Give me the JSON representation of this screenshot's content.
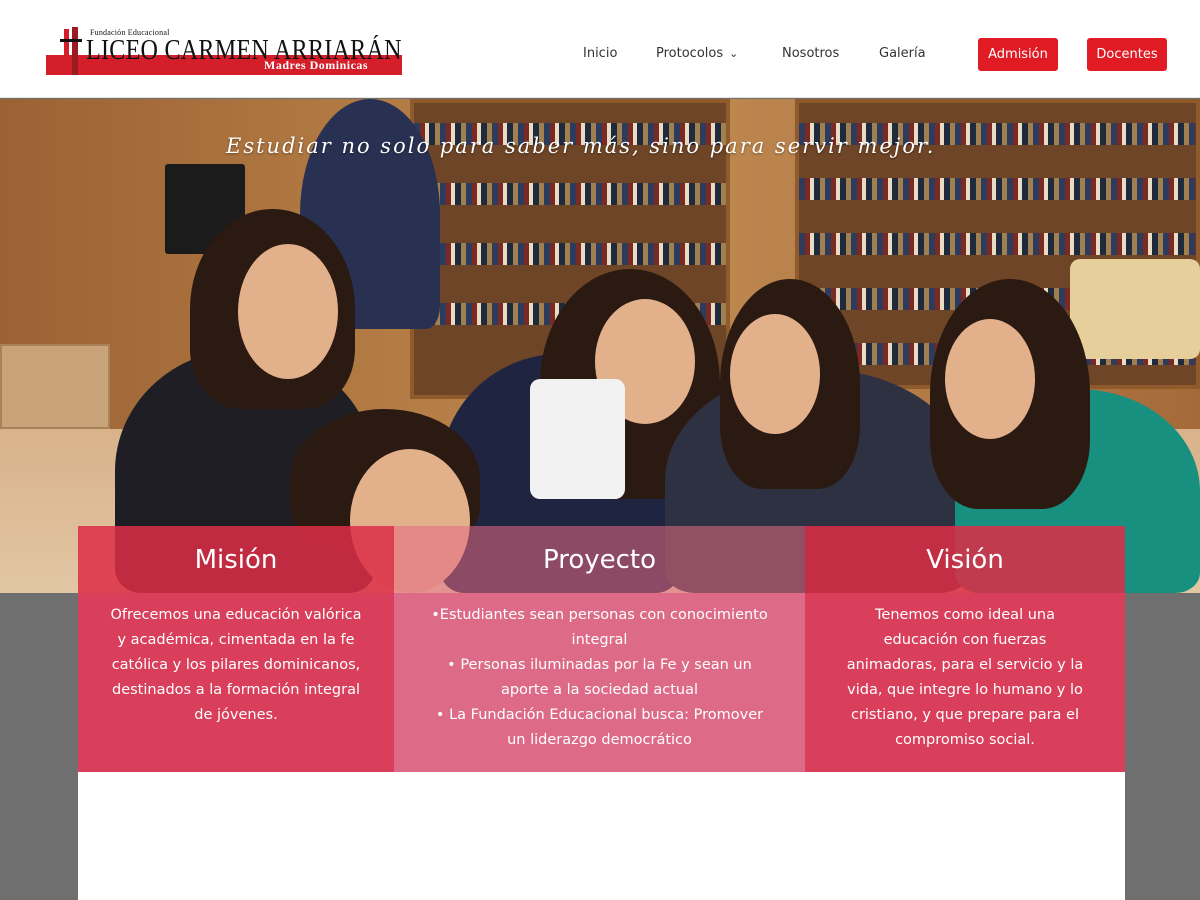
{
  "logo": {
    "foundation": "Fundación Educacional",
    "name": "LICEO CARMEN ARRIARÁN",
    "subtitle": "Madres Dominicas"
  },
  "nav": {
    "items": [
      {
        "label": "Inicio"
      },
      {
        "label": "Protocolos",
        "has_dropdown": true
      },
      {
        "label": "Nosotros"
      },
      {
        "label": "Galería"
      }
    ],
    "buttons": [
      {
        "label": "Admisión"
      },
      {
        "label": "Docentes"
      }
    ]
  },
  "hero": {
    "tagline": "Estudiar no solo para saber más, sino para servir mejor."
  },
  "cards": [
    {
      "title": "Misión",
      "text": "Ofrecemos una educación valórica\ny académica, cimentada en la fe\ncatólica y los pilares dominicanos,\ndestinados a la formación integral\nde jóvenes."
    },
    {
      "title": "Proyecto",
      "text": "•Estudiantes sean personas con conocimiento\nintegral\n• Personas iluminadas por la Fe y sean un\naporte a la sociedad actual\n• La Fundación Educacional busca: Promover\nun liderazgo democrático"
    },
    {
      "title": "Visión",
      "text": "Tenemos como ideal una\neducación con fuerzas\nanimadoras, para el servicio y la\nvida, que integre lo humano y lo\ncristiano, y que prepare para el\ncompromiso social."
    }
  ],
  "colors": {
    "brand_red": "#e01b24",
    "card_red": "#d93f5b",
    "card_pink": "#dd6a86",
    "background_gray": "#6f6f6f"
  },
  "icons": {
    "dropdown": "chevron-down-icon"
  }
}
